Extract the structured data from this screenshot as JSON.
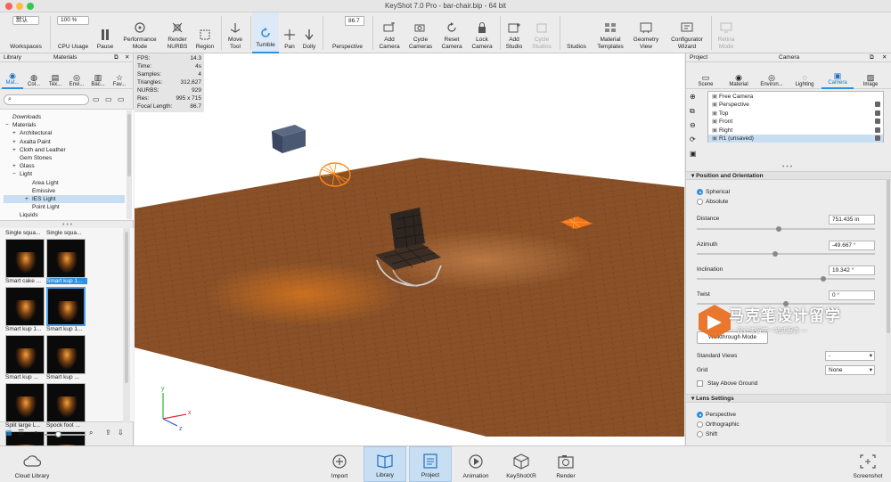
{
  "window": {
    "title": "KeyShot 7.0 Pro  -  bar-chair.bip  -  64 bit"
  },
  "colors": {
    "accent": "#2f8fe0",
    "floor": "#8a5128",
    "light": "#ff8a1a",
    "selection": "#c8dff3"
  },
  "toolbar": {
    "workspace_value": "默认",
    "cpu_value": "100 %",
    "fov_value": "86.7",
    "items": {
      "workspaces": "Workspaces",
      "cpu_usage": "CPU Usage",
      "pause": "Pause",
      "performance_mode": "Performance Mode",
      "render_nurbs": "Render NURBS",
      "region": "Region",
      "move_tool": "Move Tool",
      "tumble": "Tumble",
      "pan": "Pan",
      "dolly": "Dolly",
      "perspective": "Perspective",
      "add_camera": "Add Camera",
      "cycle_cameras": "Cycle Cameras",
      "reset_camera": "Reset Camera",
      "lock_camera": "Lock Camera",
      "add_studio": "Add Studio",
      "cycle_studios": "Cycle Studios",
      "studios": "Studios",
      "material_templates": "Material Templates",
      "geometry_view": "Geometry View",
      "configurator_wizard": "Configurator Wizard",
      "retina_mode": "Retina Mode"
    }
  },
  "library": {
    "panel_title": "Library",
    "section_title": "Materials",
    "tabs": [
      "Mat...",
      "Col...",
      "Tex...",
      "Envi...",
      "Bac...",
      "Fav..."
    ],
    "tree": [
      {
        "label": "Downloads",
        "italic": true
      },
      {
        "label": "Materials"
      },
      {
        "label": "Architectural"
      },
      {
        "label": "Axalta Paint"
      },
      {
        "label": "Cloth and Leather"
      },
      {
        "label": "Gem Stones"
      },
      {
        "label": "Glass"
      },
      {
        "label": "Light"
      },
      {
        "label": "Area Light"
      },
      {
        "label": "Emissive"
      },
      {
        "label": "IES Light"
      },
      {
        "label": "Point Light"
      },
      {
        "label": "Liquids"
      }
    ],
    "thumbs": [
      "Single squa...",
      "Single squa...",
      "Smart cake ...",
      "Smart kup 1...",
      "Smart kup 1...",
      "Smart kup 1...",
      "Smart kup ...",
      "Smart kup ...",
      "Split large L...",
      "Spock foot ..."
    ]
  },
  "viewport": {
    "stats": [
      {
        "label": "FPS:",
        "value": "14.3"
      },
      {
        "label": "Time:",
        "value": "4s"
      },
      {
        "label": "Samples:",
        "value": "4"
      },
      {
        "label": "Triangles:",
        "value": "312,627"
      },
      {
        "label": "NURBS:",
        "value": "929"
      },
      {
        "label": "Res:",
        "value": "995 x 715"
      },
      {
        "label": "Focal Length:",
        "value": "86.7"
      }
    ],
    "axes": {
      "y": "y",
      "x": "x",
      "z": "z"
    }
  },
  "project": {
    "panel_title": "Project",
    "section_title": "Camera",
    "tabs": [
      "Scene",
      "Material",
      "Environ...",
      "Lighting",
      "Camera",
      "Image"
    ],
    "cameras": [
      "Free Camera",
      "Perspective",
      "Top",
      "Front",
      "Right",
      "R1 (unsaved)"
    ],
    "position_header": "Position and Orientation",
    "spherical": "Spherical",
    "absolute": "Absolute",
    "distance_label": "Distance",
    "distance_value": "751.435 in",
    "distance_level": 0.46,
    "azimuth_label": "Azimuth",
    "azimuth_value": "-49.667 °",
    "azimuth_level": 0.44,
    "inclination_label": "Inclination",
    "inclination_value": "19.342 °",
    "inclination_level": 0.71,
    "twist_label": "Twist",
    "twist_value": "0 °",
    "twist_level": 0.5,
    "walkthrough_label": "Walkthrough Mode",
    "standard_views_label": "Standard Views",
    "standard_views_value": "-",
    "grid_label": "Grid",
    "grid_value": "None",
    "stay_above_label": "Stay Above Ground",
    "lens_header": "Lens Settings",
    "lens_perspective": "Perspective",
    "lens_orthographic": "Orthographic",
    "lens_shift": "Shift"
  },
  "watermark": {
    "title": "马克笔设计留学",
    "subtitle": "— 设计类留学一站式服务 —"
  },
  "bottombar": {
    "cloud_library": "Cloud Library",
    "import": "Import",
    "library": "Library",
    "project": "Project",
    "animation": "Animation",
    "keyshotxr": "KeyShotXR",
    "render": "Render",
    "screenshot": "Screenshot"
  }
}
